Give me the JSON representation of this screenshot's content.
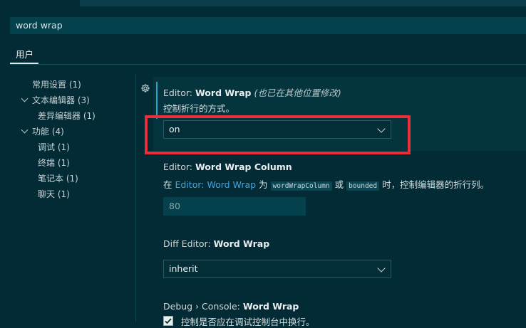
{
  "search": {
    "value": "word wrap"
  },
  "tabs": [
    {
      "label": "用户"
    }
  ],
  "toc": [
    {
      "label": "常用设置",
      "count": "(1)",
      "expandable": false
    },
    {
      "label": "文本编辑器",
      "count": "(3)",
      "expandable": true
    },
    {
      "label": "差异编辑器",
      "count": "(1)",
      "expandable": false
    },
    {
      "label": "功能",
      "count": "(4)",
      "expandable": true
    },
    {
      "label": "调试",
      "count": "(1)",
      "expandable": false
    },
    {
      "label": "终端",
      "count": "(1)",
      "expandable": false
    },
    {
      "label": "笔记本",
      "count": "(1)",
      "expandable": false
    },
    {
      "label": "聊天",
      "count": "(1)",
      "expandable": false
    }
  ],
  "settings": {
    "word_wrap": {
      "category": "Editor: ",
      "name": "Word Wrap",
      "note": "(也已在其他位置修改)",
      "description": "控制折行的方式。",
      "value": "on"
    },
    "word_wrap_column": {
      "category": "Editor: ",
      "name": "Word Wrap Column",
      "desc_prefix": "在 ",
      "desc_link": "Editor: Word Wrap",
      "desc_mid1": " 为 ",
      "code1": "wordWrapColumn",
      "desc_mid2": " 或 ",
      "code2": "bounded",
      "desc_suffix": " 时，控制编辑器的折行列。",
      "value": "80"
    },
    "diff_word_wrap": {
      "category": "Diff Editor: ",
      "name": "Word Wrap",
      "value": "inherit"
    },
    "debug_word_wrap": {
      "category": "Debug › Console: ",
      "name": "Word Wrap",
      "checkbox_label": "控制是否应在调试控制台中换行。"
    }
  },
  "colors": {
    "background": "#022b35",
    "accent_link": "#3ea6e6",
    "annotation_red": "#ea2f3a"
  }
}
